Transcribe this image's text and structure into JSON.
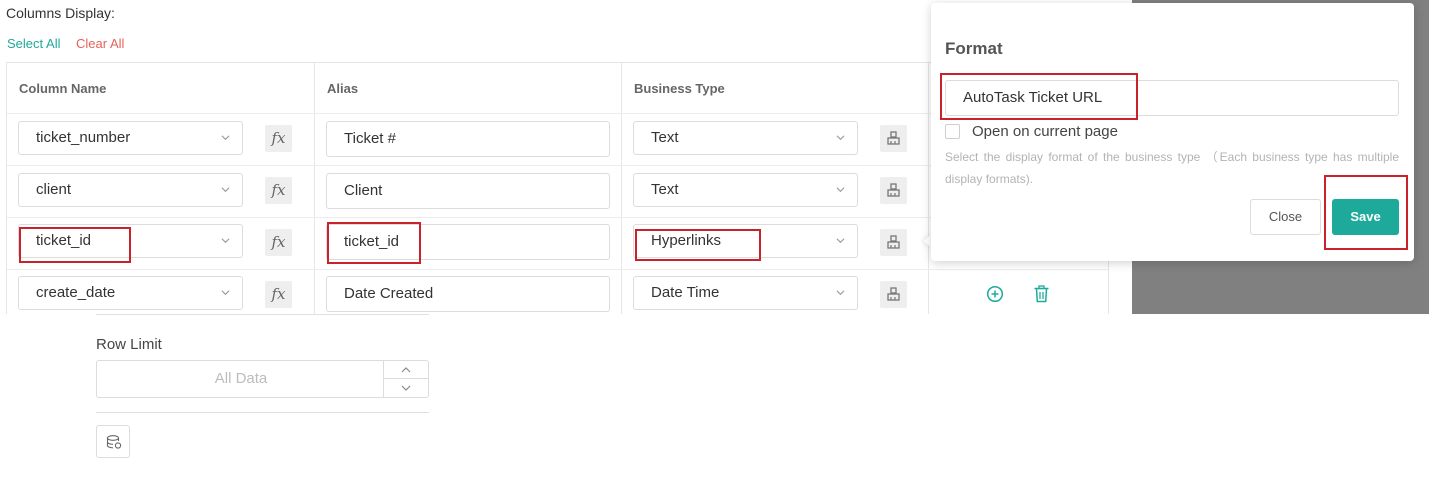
{
  "section": {
    "title": "Columns Display:",
    "select_all": "Select All",
    "clear_all": "Clear All"
  },
  "table": {
    "headers": {
      "column_name": "Column Name",
      "alias": "Alias",
      "business_type": "Business Type"
    },
    "rows": [
      {
        "column": "ticket_number",
        "alias": "Ticket #",
        "business_type": "Text"
      },
      {
        "column": "client",
        "alias": "Client",
        "business_type": "Text"
      },
      {
        "column": "ticket_id",
        "alias": "ticket_id",
        "business_type": "Hyperlinks"
      },
      {
        "column": "create_date",
        "alias": "Date Created",
        "business_type": "Date Time"
      }
    ],
    "fx_label": "fx"
  },
  "format_popover": {
    "title": "Format",
    "value": "AutoTask Ticket URL",
    "open_current_page_label": "Open on current page",
    "open_current_page_checked": false,
    "hint": "Select the display format of the business type （Each business type has multiple display formats).",
    "close_label": "Close",
    "save_label": "Save"
  },
  "row_limit": {
    "label": "Row Limit",
    "placeholder": "All Data"
  },
  "colors": {
    "accent": "#1eaa9b",
    "danger_link": "#e8615a",
    "highlight_box": "#c8222b",
    "overlay": "#808080"
  },
  "icons": [
    "chevron-down-icon",
    "fx-icon",
    "format-brush-icon",
    "add-circle-icon",
    "trash-icon",
    "chevron-up-icon",
    "database-icon"
  ]
}
